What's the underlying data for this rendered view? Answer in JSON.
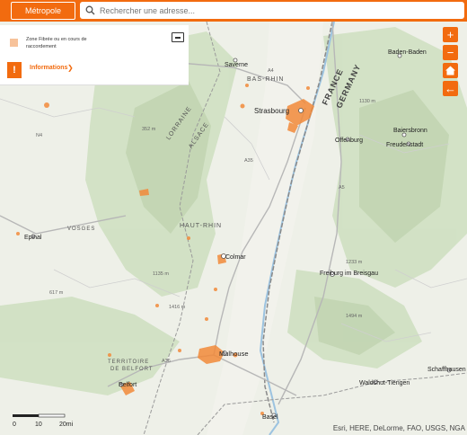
{
  "header": {
    "metropole_button": "Métropole",
    "search_placeholder": "Rechercher une adresse..."
  },
  "legend": {
    "zone_label": "Zone Fibrée ou en cours de raccordement",
    "zone_color": "#f7c29a",
    "info_label": "Informations",
    "info_icon": "!"
  },
  "controls": {
    "zoom_in": "+",
    "zoom_out": "−",
    "home_icon": "home-icon",
    "back_icon": "←"
  },
  "map": {
    "places": {
      "saverne": "Saverne",
      "strasbourg": "Strasbourg",
      "offenburg": "Offenburg",
      "baden_baden": "Baden-Baden",
      "baiersbronn": "Baiersbronn",
      "freudenstadt": "Freudenstadt",
      "epinal": "Epinal",
      "colmar": "Colmar",
      "freiburg": "Freiburg im Breisgau",
      "mulhouse": "Mulhouse",
      "belfort": "Belfort",
      "waldshut": "Waldshut-Tiengen",
      "schaffhausen": "Schaffhausen",
      "basel": "Basel"
    },
    "regions": {
      "bas_rhin": "BAS-RHIN",
      "haut_rhin": "HAUT-RHIN",
      "vosges": "VOSGES",
      "lorraine": "LORRAINE",
      "alsace": "ALSACE",
      "territoire1": "TERRITOIRE",
      "territoire2": "DE BELFORT",
      "france": "FRANCE",
      "germany": "GERMANY"
    },
    "roads": {
      "a4": "A4",
      "a35": "A35",
      "a5": "A5",
      "a36": "A36",
      "n4": "N4"
    },
    "elevations": {
      "e1": "352 m",
      "e2": "1130 m",
      "e3": "1233 m",
      "e4": "1494 m",
      "e5": "1416 m",
      "e6": "1135 m",
      "e7": "617 m"
    }
  },
  "scale": {
    "s0": "0",
    "s1": "10",
    "s2": "20mi"
  },
  "attribution": "Esri, HERE, DeLorme, FAO, USGS, NGA"
}
